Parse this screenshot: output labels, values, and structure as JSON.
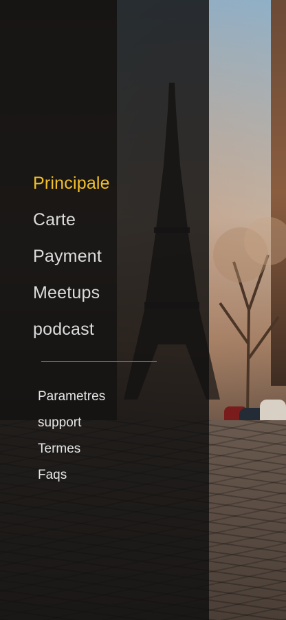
{
  "menu": {
    "main_items": [
      {
        "label": "Principale",
        "active": true
      },
      {
        "label": "Carte",
        "active": false
      },
      {
        "label": "Payment",
        "active": false
      },
      {
        "label": "Meetups",
        "active": false
      },
      {
        "label": "podcast",
        "active": false
      }
    ],
    "secondary_items": [
      {
        "label": "Parametres"
      },
      {
        "label": "support"
      },
      {
        "label": "Termes"
      },
      {
        "label": "Faqs"
      }
    ]
  },
  "colors": {
    "active": "#f3c02a",
    "text": "#dcdcdc",
    "divider": "#9a7a2c",
    "overlay": "rgba(16,16,16,0.82)"
  },
  "background_image": "Paris street with Eiffel Tower"
}
